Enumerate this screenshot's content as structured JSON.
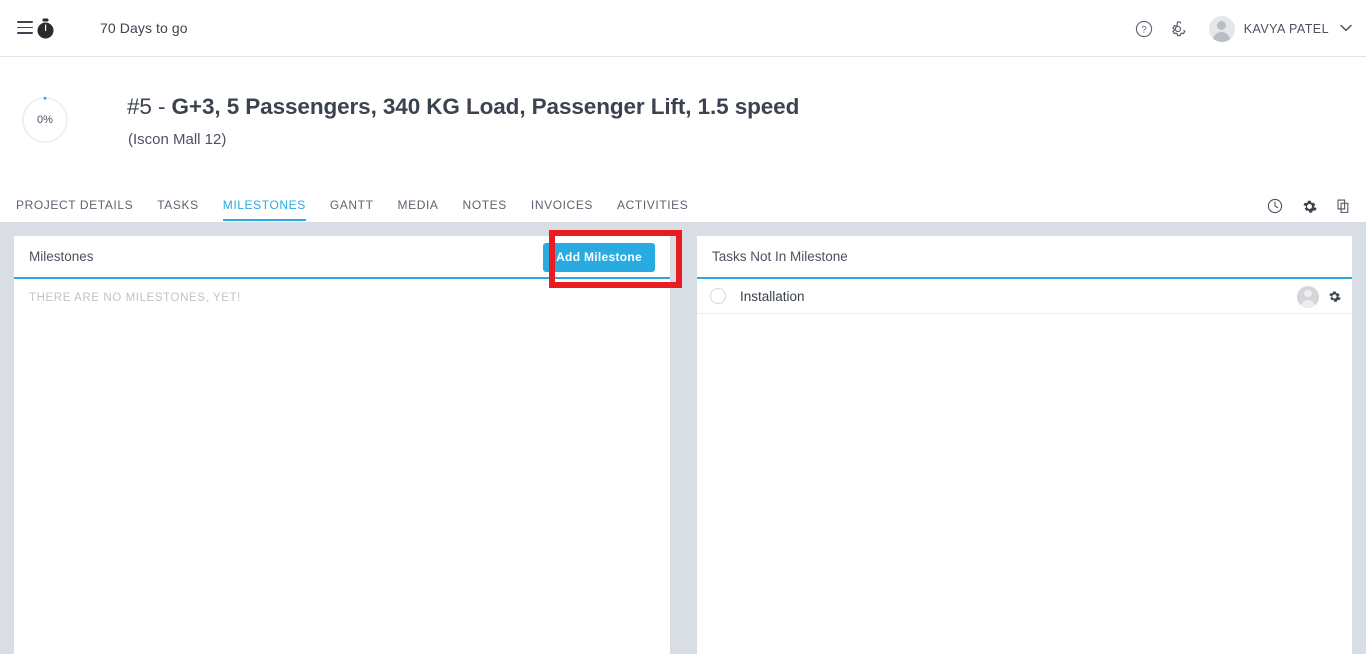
{
  "topbar": {
    "menu_icon": "hamburger-icon",
    "timer_icon": "stopwatch-icon",
    "days_to_go": "70 Days to go",
    "help_icon": "help-circle-icon",
    "settings_icon": "gear-icon",
    "user_name": "KAVYA PATEL",
    "user_caret_icon": "chevron-down-icon"
  },
  "project": {
    "progress_percent": "0%",
    "progress_value": 0,
    "title_number": "#5",
    "title_separator": " - ",
    "title_text": "G+3, 5 Passengers, 340 KG Load, Passenger Lift, 1.5 speed",
    "subtitle": "(Iscon Mall 12)"
  },
  "tabs": [
    {
      "label": "PROJECT DETAILS",
      "active": false
    },
    {
      "label": "TASKS",
      "active": false
    },
    {
      "label": "MILESTONES",
      "active": true
    },
    {
      "label": "GANTT",
      "active": false
    },
    {
      "label": "MEDIA",
      "active": false
    },
    {
      "label": "NOTES",
      "active": false
    },
    {
      "label": "INVOICES",
      "active": false
    },
    {
      "label": "ACTIVITIES",
      "active": false
    }
  ],
  "tab_actions": [
    {
      "icon": "clock-icon"
    },
    {
      "icon": "gear-icon"
    },
    {
      "icon": "copy-icon"
    }
  ],
  "milestones_panel": {
    "title": "Milestones",
    "add_button_label": "Add Milestone",
    "empty_message": "THERE ARE NO MILESTONES, YET!"
  },
  "tasks_panel": {
    "title": "Tasks Not In Milestone",
    "rows": [
      {
        "name": "Installation",
        "checkbox": "unchecked",
        "avatar_icon": "user-avatar-icon",
        "settings_icon": "gear-icon"
      }
    ]
  },
  "annotation": {
    "highlight_color": "#e81d21",
    "target": "add-milestone-button"
  },
  "colors": {
    "accent": "#29abe2",
    "content_background": "#d9dde4",
    "panel_background": "#ffffff",
    "text_primary": "#3b4250",
    "text_muted": "#bfc3ca"
  }
}
